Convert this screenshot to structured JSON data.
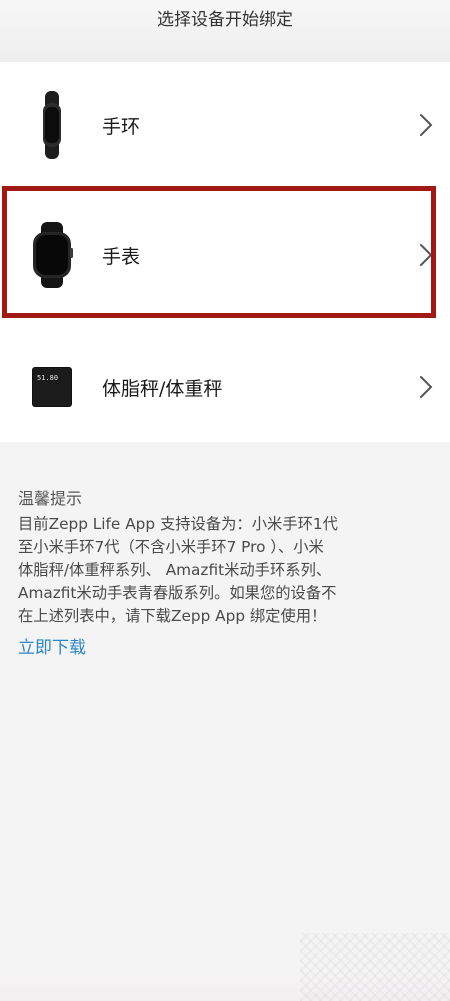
{
  "header": {
    "title": "选择设备开始绑定"
  },
  "devices": [
    {
      "label": "手环",
      "icon": "band-icon"
    },
    {
      "label": "手表",
      "icon": "watch-icon"
    },
    {
      "label": "体脂秤/体重秤",
      "icon": "scale-icon",
      "screen_text": "51.80"
    }
  ],
  "notice": {
    "title": "温馨提示",
    "lines": [
      "目前Zepp Life App 支持设备为：小米手环1代",
      "至小米手环7代（不含小米手环7 Pro ）、小米",
      "体脂秤/体重秤系列、 Amazfit米动手环系列、",
      "Amazfit米动手表青春版系列。如果您的设备不",
      "在上述列表中，请下载Zepp App 绑定使用！"
    ],
    "link": "立即下载"
  },
  "colors": {
    "highlight": "#a21815",
    "link": "#2b86c6",
    "background": "#f4f4f4"
  }
}
